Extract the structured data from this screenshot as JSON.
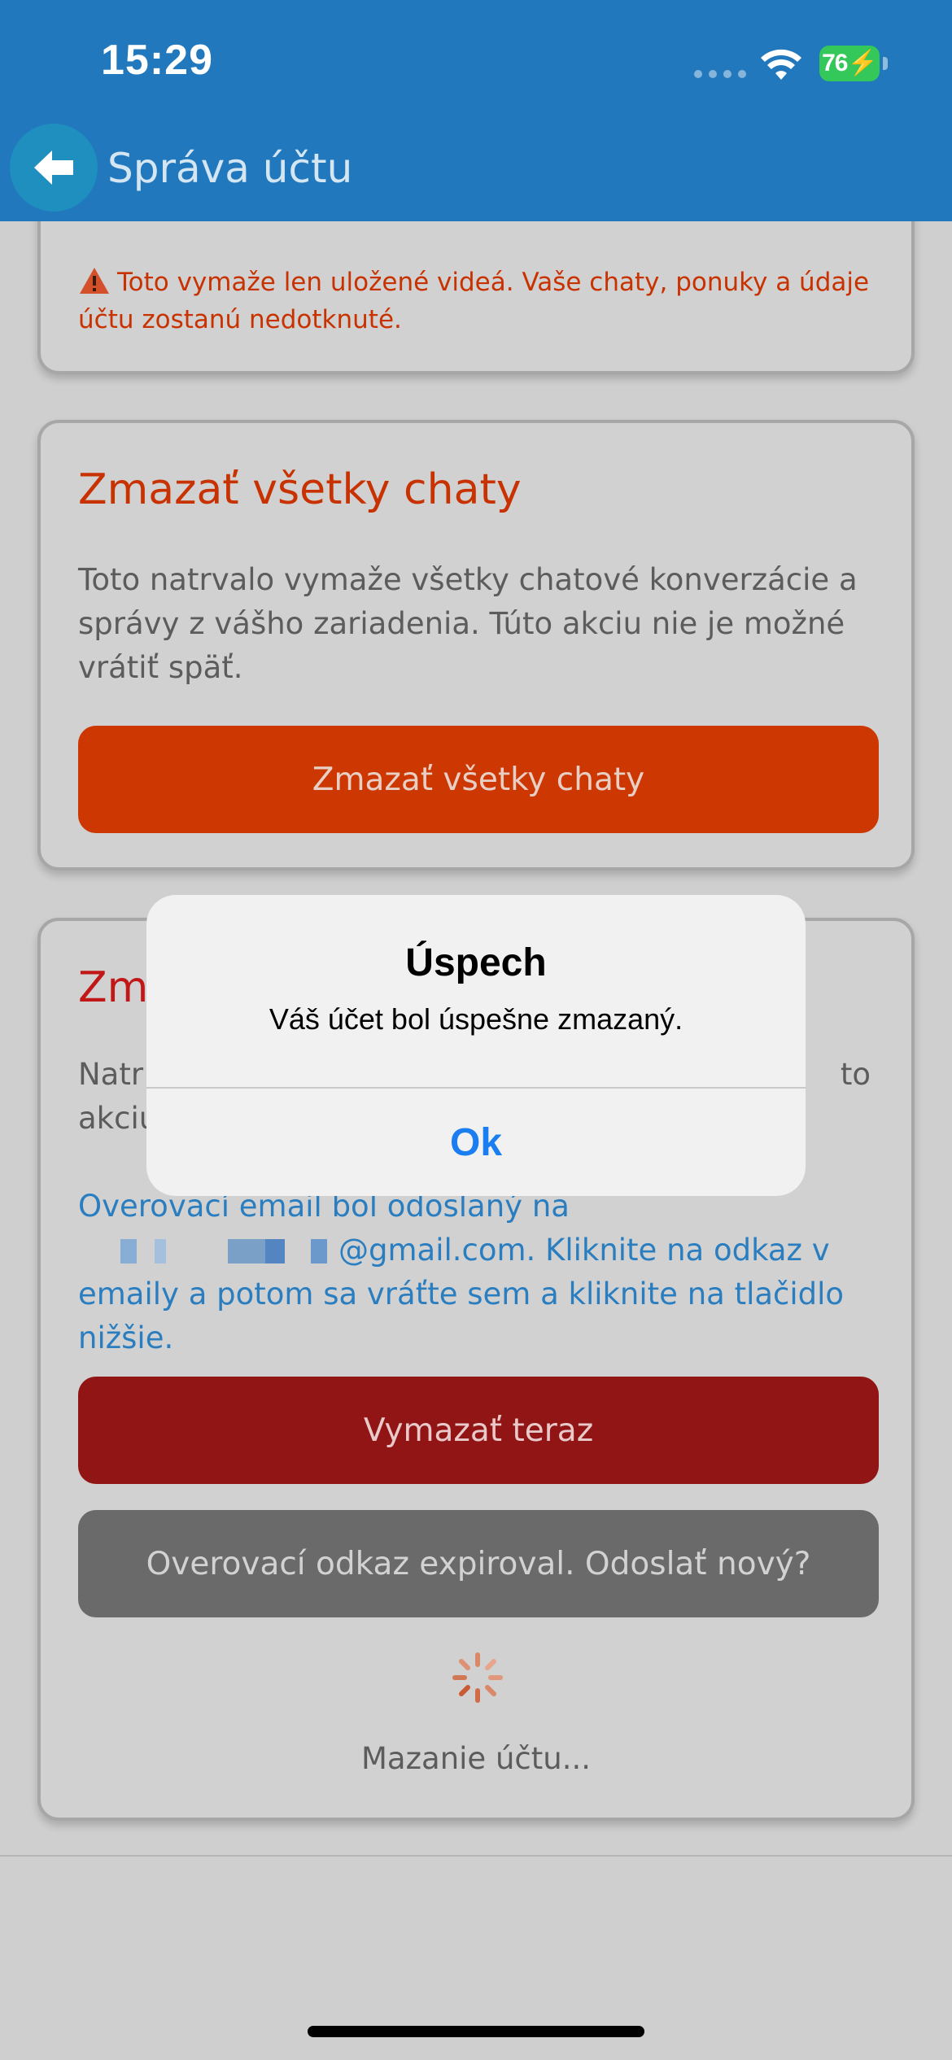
{
  "status_bar": {
    "time": "15:29",
    "battery": "76"
  },
  "nav": {
    "title": "Správa účtu",
    "back_icon": "arrow-left-icon"
  },
  "videos_card": {
    "warning": "Toto vymaže len uložené videá. Vaše chaty, ponuky a údaje účtu zostanú nedotknuté."
  },
  "chats_card": {
    "title": "Zmazať všetky chaty",
    "description": "Toto natrvalo vymaže všetky chatové konverzácie a správy z vášho zariadenia. Túto akciu nie je možné vrátiť späť.",
    "button": "Zmazať všetky chaty"
  },
  "account_card": {
    "title_visible": "Zma",
    "desc_line1_start": "Natr",
    "desc_line1_end": "to",
    "desc_line2_start": "akciu",
    "verify_prefix": "Overovací email bol odoslaný na",
    "verify_email_suffix": "@gmail.com. Kliknite na odkaz v emaily a potom sa vráťte sem a kliknite na tlačidlo nižšie.",
    "delete_now_button": "Vymazať teraz",
    "resend_button": "Overovací odkaz expiroval. Odoslať nový?",
    "loading_text": "Mazanie účtu..."
  },
  "alert": {
    "title": "Úspech",
    "message": "Váš účet bol úspešne zmazaný.",
    "ok_button": "Ok"
  },
  "colors": {
    "header": "#2178bd",
    "danger_orange": "#cd3701",
    "danger_red": "#921515",
    "link_blue": "#2a7ec0",
    "alert_ok": "#1a7ef0"
  }
}
